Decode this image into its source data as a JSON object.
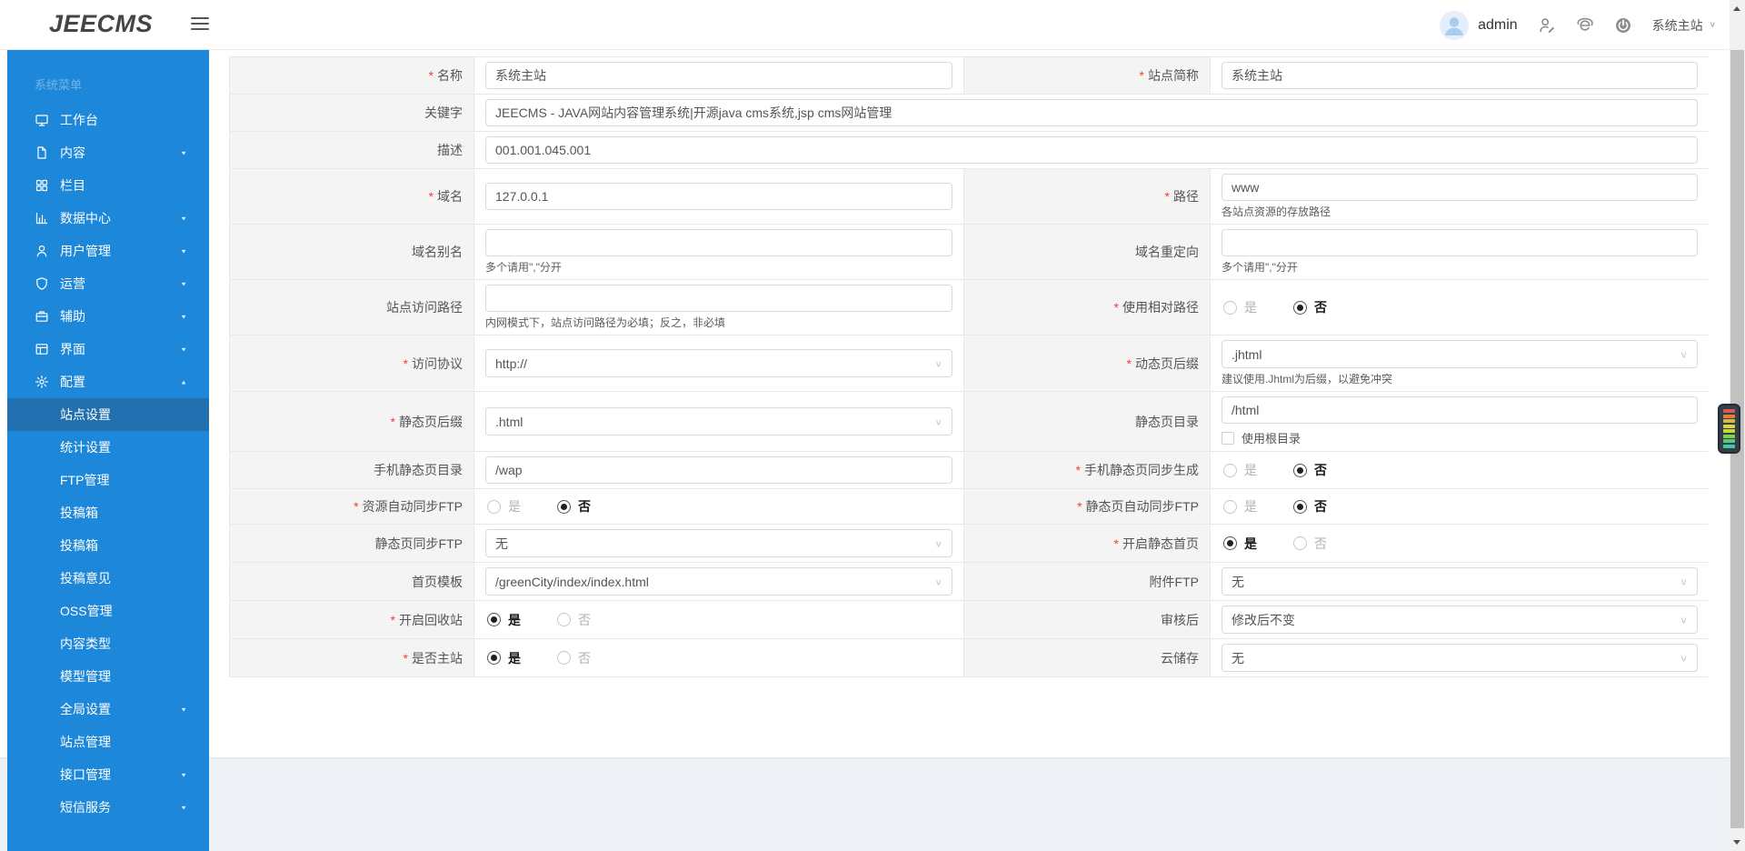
{
  "header": {
    "logo": "JEECMS",
    "user": "admin",
    "site_selector": "系统主站",
    "icons": [
      "user-edit-icon",
      "browser-icon",
      "power-icon"
    ],
    "accent_color": "#1d87d9"
  },
  "sidebar": {
    "title": "系统菜单",
    "items": [
      {
        "label": "工作台",
        "icon": "monitor-icon",
        "arrow": ""
      },
      {
        "label": "内容",
        "icon": "document-icon",
        "arrow": "down"
      },
      {
        "label": "栏目",
        "icon": "grid-icon",
        "arrow": ""
      },
      {
        "label": "数据中心",
        "icon": "chart-icon",
        "arrow": "down"
      },
      {
        "label": "用户管理",
        "icon": "user-icon",
        "arrow": "down"
      },
      {
        "label": "运营",
        "icon": "shield-icon",
        "arrow": "down"
      },
      {
        "label": "辅助",
        "icon": "briefcase-icon",
        "arrow": "down"
      },
      {
        "label": "界面",
        "icon": "layout-icon",
        "arrow": "down"
      },
      {
        "label": "配置",
        "icon": "gear-icon",
        "arrow": "up"
      }
    ],
    "subitems": [
      {
        "label": "站点设置",
        "active": true,
        "arrow": ""
      },
      {
        "label": "统计设置",
        "active": false,
        "arrow": ""
      },
      {
        "label": "FTP管理",
        "active": false,
        "arrow": ""
      },
      {
        "label": "投稿箱",
        "active": false,
        "arrow": ""
      },
      {
        "label": "投稿箱",
        "active": false,
        "arrow": ""
      },
      {
        "label": "投稿意见",
        "active": false,
        "arrow": ""
      },
      {
        "label": "OSS管理",
        "active": false,
        "arrow": ""
      },
      {
        "label": "内容类型",
        "active": false,
        "arrow": ""
      },
      {
        "label": "模型管理",
        "active": false,
        "arrow": ""
      },
      {
        "label": "全局设置",
        "active": false,
        "arrow": "down"
      },
      {
        "label": "站点管理",
        "active": false,
        "arrow": ""
      },
      {
        "label": "接口管理",
        "active": false,
        "arrow": "down"
      },
      {
        "label": "短信服务",
        "active": false,
        "arrow": "down"
      }
    ]
  },
  "form": {
    "required_mark": "*",
    "rows": [
      {
        "cells": [
          {
            "label": "名称",
            "required": true
          },
          {
            "field": {
              "kind": "input",
              "value": "系统主站"
            }
          },
          {
            "label": "站点简称",
            "required": true
          },
          {
            "field": {
              "kind": "input",
              "value": "系统主站"
            }
          }
        ]
      },
      {
        "span": true,
        "cells": [
          {
            "label": "关键字",
            "required": false
          },
          {
            "field": {
              "kind": "input",
              "value": "JEECMS - JAVA网站内容管理系统|开源java cms系统,jsp cms网站管理"
            }
          }
        ]
      },
      {
        "span": true,
        "cells": [
          {
            "label": "描述",
            "required": false
          },
          {
            "field": {
              "kind": "input",
              "value": "001.001.045.001"
            }
          }
        ]
      },
      {
        "cells": [
          {
            "label": "域名",
            "required": true
          },
          {
            "field": {
              "kind": "input",
              "value": "127.0.0.1"
            }
          },
          {
            "label": "路径",
            "required": true
          },
          {
            "field": {
              "kind": "input",
              "value": "www",
              "hint": "各站点资源的存放路径"
            }
          }
        ]
      },
      {
        "cells": [
          {
            "label": "域名别名",
            "required": false
          },
          {
            "field": {
              "kind": "input",
              "value": "",
              "hint": "多个请用\",\"分开"
            }
          },
          {
            "label": "域名重定向",
            "required": false
          },
          {
            "field": {
              "kind": "input",
              "value": "",
              "hint": "多个请用\",\"分开"
            }
          }
        ]
      },
      {
        "cells": [
          {
            "label": "站点访问路径",
            "required": false
          },
          {
            "field": {
              "kind": "input",
              "value": "",
              "hint": "内网模式下，站点访问路径为必填；反之，非必填"
            }
          },
          {
            "label": "使用相对路径",
            "required": true
          },
          {
            "field": {
              "kind": "radio",
              "options": [
                {
                  "label": "是",
                  "selected": false
                },
                {
                  "label": "否",
                  "selected": true
                }
              ]
            }
          }
        ]
      },
      {
        "cells": [
          {
            "label": "访问协议",
            "required": true
          },
          {
            "field": {
              "kind": "select",
              "value": "http://"
            }
          },
          {
            "label": "动态页后缀",
            "required": true
          },
          {
            "field": {
              "kind": "select",
              "value": ".jhtml",
              "hint": "建议使用.Jhtml为后缀，以避免冲突"
            }
          }
        ]
      },
      {
        "cells": [
          {
            "label": "静态页后缀",
            "required": true
          },
          {
            "field": {
              "kind": "select",
              "value": ".html"
            }
          },
          {
            "label": "静态页目录",
            "required": false
          },
          {
            "field": {
              "kind": "input",
              "value": "/html",
              "checkbox": {
                "label": "使用根目录",
                "checked": false
              }
            }
          }
        ]
      },
      {
        "cells": [
          {
            "label": "手机静态页目录",
            "required": false
          },
          {
            "field": {
              "kind": "input",
              "value": "/wap"
            }
          },
          {
            "label": "手机静态页同步生成",
            "required": true
          },
          {
            "field": {
              "kind": "radio",
              "options": [
                {
                  "label": "是",
                  "selected": false
                },
                {
                  "label": "否",
                  "selected": true
                }
              ]
            }
          }
        ]
      },
      {
        "cells": [
          {
            "label": "资源自动同步FTP",
            "required": true
          },
          {
            "field": {
              "kind": "radio",
              "options": [
                {
                  "label": "是",
                  "selected": false
                },
                {
                  "label": "否",
                  "selected": true
                }
              ]
            }
          },
          {
            "label": "静态页自动同步FTP",
            "required": true
          },
          {
            "field": {
              "kind": "radio",
              "options": [
                {
                  "label": "是",
                  "selected": false
                },
                {
                  "label": "否",
                  "selected": true
                }
              ]
            }
          }
        ]
      },
      {
        "cells": [
          {
            "label": "静态页同步FTP",
            "required": false
          },
          {
            "field": {
              "kind": "select",
              "value": "无"
            }
          },
          {
            "label": "开启静态首页",
            "required": true
          },
          {
            "field": {
              "kind": "radio",
              "options": [
                {
                  "label": "是",
                  "selected": true
                },
                {
                  "label": "否",
                  "selected": false
                }
              ]
            }
          }
        ]
      },
      {
        "cells": [
          {
            "label": "首页模板",
            "required": false
          },
          {
            "field": {
              "kind": "select",
              "value": "/greenCity/index/index.html"
            }
          },
          {
            "label": "附件FTP",
            "required": false
          },
          {
            "field": {
              "kind": "select",
              "value": "无"
            }
          }
        ]
      },
      {
        "cells": [
          {
            "label": "开启回收站",
            "required": true
          },
          {
            "field": {
              "kind": "radio",
              "options": [
                {
                  "label": "是",
                  "selected": true
                },
                {
                  "label": "否",
                  "selected": false
                }
              ]
            }
          },
          {
            "label": "审核后",
            "required": false
          },
          {
            "field": {
              "kind": "select",
              "value": "修改后不变"
            }
          }
        ]
      },
      {
        "cells": [
          {
            "label": "是否主站",
            "required": true
          },
          {
            "field": {
              "kind": "radio",
              "options": [
                {
                  "label": "是",
                  "selected": true
                },
                {
                  "label": "否",
                  "selected": false
                }
              ]
            }
          },
          {
            "label": "云储存",
            "required": false
          },
          {
            "field": {
              "kind": "select",
              "value": "无"
            }
          }
        ]
      }
    ]
  }
}
